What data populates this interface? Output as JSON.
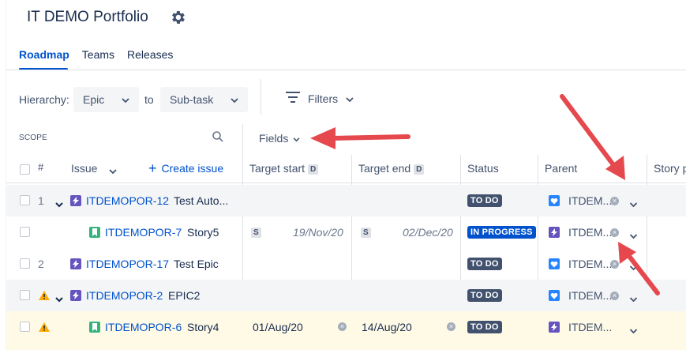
{
  "app": {
    "title": "IT DEMO Portfolio",
    "accent": "#0052cc",
    "arrow_color": "#e5484d"
  },
  "tabs": [
    {
      "label": "Roadmap",
      "active": true
    },
    {
      "label": "Teams",
      "active": false
    },
    {
      "label": "Releases",
      "active": false
    }
  ],
  "toolbar": {
    "hierarchy_label": "Hierarchy:",
    "from_value": "Epic",
    "to_label": "to",
    "to_value": "Sub-task",
    "filters_label": "Filters"
  },
  "scope": {
    "label": "SCOPE",
    "fields_label": "Fields"
  },
  "columns": {
    "number": "#",
    "issue": "Issue",
    "create_issue": "Create issue",
    "target_start": "Target start",
    "target_end": "Target end",
    "date_badge": "D",
    "status": "Status",
    "parent": "Parent",
    "story_points": "Story p"
  },
  "rows": [
    {
      "num": "1",
      "key": "ITDEMOPOR-12",
      "summary": "Test Auto...",
      "type": "epic",
      "start": "",
      "end": "",
      "status": "TO DO",
      "parent": "ITDEM...",
      "parent_icon": "heart-icon",
      "warning": false
    },
    {
      "num": "",
      "key": "ITDEMOPOR-7",
      "summary": "Story5",
      "type": "story",
      "start_badge": "S",
      "start": "19/Nov/20",
      "end_badge": "S",
      "end": "02/Dec/20",
      "status": "IN PROGRESS",
      "parent": "ITDEM...",
      "parent_icon": "epic-icon",
      "warning": false
    },
    {
      "num": "2",
      "key": "ITDEMOPOR-17",
      "summary": "Test Epic",
      "type": "epic",
      "start": "",
      "end": "",
      "status": "TO DO",
      "parent": "ITDEM...",
      "parent_icon": "heart-icon",
      "warning": false
    },
    {
      "num": "",
      "key": "ITDEMOPOR-2",
      "summary": "EPIC2",
      "type": "epic",
      "start": "",
      "end": "",
      "status": "TO DO",
      "parent": "ITDEM...",
      "parent_icon": "heart-icon",
      "warning": true
    },
    {
      "num": "",
      "key": "ITDEMOPOR-6",
      "summary": "Story4",
      "type": "story",
      "start": "01/Aug/20",
      "end": "14/Aug/20",
      "status": "TO DO",
      "parent": "ITDEM...",
      "parent_icon": "epic-icon",
      "warning": true
    }
  ]
}
